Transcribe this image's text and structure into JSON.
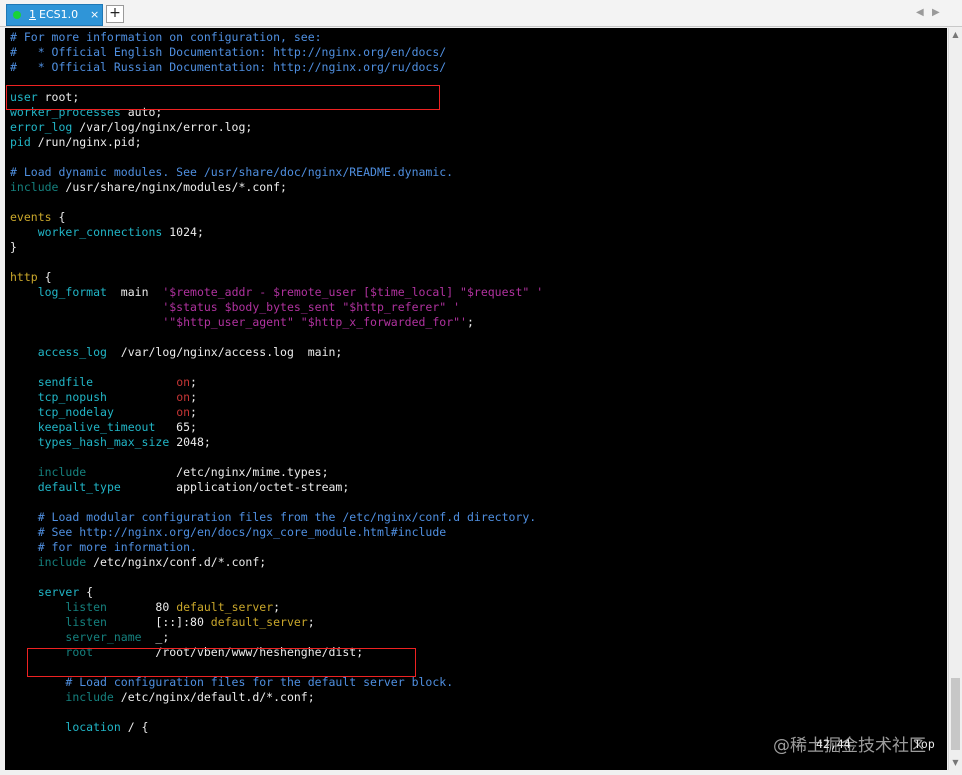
{
  "tabs": [
    {
      "number": "1",
      "label": "ECS1.0",
      "close": "×"
    }
  ],
  "new_tab_label": "+",
  "nav": {
    "prev": "◀",
    "next": "▶"
  },
  "lines": [
    [
      {
        "t": "# For more information on configuration, see:",
        "c": "comment"
      }
    ],
    [
      {
        "t": "#   * Official English Documentation: http://nginx.org/en/docs/",
        "c": "comment"
      }
    ],
    [
      {
        "t": "#   * Official Russian Documentation: http://nginx.org/ru/docs/",
        "c": "comment"
      }
    ],
    [
      {
        "t": ""
      }
    ],
    [
      {
        "t": "user",
        "c": "key"
      },
      {
        "t": " root;"
      }
    ],
    [
      {
        "t": "worker_processes",
        "c": "key"
      },
      {
        "t": " auto;"
      }
    ],
    [
      {
        "t": "error_log",
        "c": "key"
      },
      {
        "t": " /var/log/nginx/error.log;"
      }
    ],
    [
      {
        "t": "pid",
        "c": "key"
      },
      {
        "t": " /run/nginx.pid;"
      }
    ],
    [
      {
        "t": ""
      }
    ],
    [
      {
        "t": "# Load dynamic modules. See /usr/share/doc/nginx/README.dynamic.",
        "c": "comment"
      }
    ],
    [
      {
        "t": "include",
        "c": "dim"
      },
      {
        "t": " /usr/share/nginx/modules/*.conf;"
      }
    ],
    [
      {
        "t": ""
      }
    ],
    [
      {
        "t": "events",
        "c": "val"
      },
      {
        "t": " {"
      }
    ],
    [
      {
        "t": "    "
      },
      {
        "t": "worker_connections",
        "c": "key"
      },
      {
        "t": " 1024;"
      }
    ],
    [
      {
        "t": "}"
      }
    ],
    [
      {
        "t": ""
      }
    ],
    [
      {
        "t": "http",
        "c": "val"
      },
      {
        "t": " {"
      }
    ],
    [
      {
        "t": "    "
      },
      {
        "t": "log_format",
        "c": "key"
      },
      {
        "t": "  main  "
      },
      {
        "t": "'$remote_addr - $remote_user [$time_local] \"$request\" '",
        "c": "str"
      }
    ],
    [
      {
        "t": "                      "
      },
      {
        "t": "'$status $body_bytes_sent \"$http_referer\" '",
        "c": "str"
      }
    ],
    [
      {
        "t": "                      "
      },
      {
        "t": "'\"$http_user_agent\" \"$http_x_forwarded_for\"'",
        "c": "str"
      },
      {
        "t": ";"
      }
    ],
    [
      {
        "t": ""
      }
    ],
    [
      {
        "t": "    "
      },
      {
        "t": "access_log",
        "c": "key"
      },
      {
        "t": "  /var/log/nginx/access.log  main;"
      }
    ],
    [
      {
        "t": ""
      }
    ],
    [
      {
        "t": "    "
      },
      {
        "t": "sendfile",
        "c": "key"
      },
      {
        "t": "            "
      },
      {
        "t": "on",
        "c": "on"
      },
      {
        "t": ";"
      }
    ],
    [
      {
        "t": "    "
      },
      {
        "t": "tcp_nopush",
        "c": "key"
      },
      {
        "t": "          "
      },
      {
        "t": "on",
        "c": "on"
      },
      {
        "t": ";"
      }
    ],
    [
      {
        "t": "    "
      },
      {
        "t": "tcp_nodelay",
        "c": "key"
      },
      {
        "t": "         "
      },
      {
        "t": "on",
        "c": "on"
      },
      {
        "t": ";"
      }
    ],
    [
      {
        "t": "    "
      },
      {
        "t": "keepalive_timeout",
        "c": "key"
      },
      {
        "t": "   65;"
      }
    ],
    [
      {
        "t": "    "
      },
      {
        "t": "types_hash_max_size",
        "c": "key"
      },
      {
        "t": " 2048;"
      }
    ],
    [
      {
        "t": ""
      }
    ],
    [
      {
        "t": "    "
      },
      {
        "t": "include",
        "c": "dim"
      },
      {
        "t": "             /etc/nginx/mime.types;"
      }
    ],
    [
      {
        "t": "    "
      },
      {
        "t": "default_type",
        "c": "key"
      },
      {
        "t": "        application/octet-stream;"
      }
    ],
    [
      {
        "t": ""
      }
    ],
    [
      {
        "t": "    "
      },
      {
        "t": "# Load modular configuration files from the /etc/nginx/conf.d directory.",
        "c": "comment"
      }
    ],
    [
      {
        "t": "    "
      },
      {
        "t": "# See http://nginx.org/en/docs/ngx_core_module.html#include",
        "c": "comment"
      }
    ],
    [
      {
        "t": "    "
      },
      {
        "t": "# for more information.",
        "c": "comment"
      }
    ],
    [
      {
        "t": "    "
      },
      {
        "t": "include",
        "c": "dim"
      },
      {
        "t": " /etc/nginx/conf.d/*.conf;"
      }
    ],
    [
      {
        "t": ""
      }
    ],
    [
      {
        "t": "    "
      },
      {
        "t": "server",
        "c": "key"
      },
      {
        "t": " {"
      }
    ],
    [
      {
        "t": "        "
      },
      {
        "t": "listen",
        "c": "dim"
      },
      {
        "t": "       80 "
      },
      {
        "t": "default_server",
        "c": "val"
      },
      {
        "t": ";"
      }
    ],
    [
      {
        "t": "        "
      },
      {
        "t": "listen",
        "c": "dim"
      },
      {
        "t": "       [::]:80 "
      },
      {
        "t": "default_server",
        "c": "val"
      },
      {
        "t": ";"
      }
    ],
    [
      {
        "t": "        "
      },
      {
        "t": "server_name",
        "c": "dim"
      },
      {
        "t": "  _;"
      }
    ],
    [
      {
        "t": "        "
      },
      {
        "t": "root",
        "c": "dim"
      },
      {
        "t": "         /root/vben/www/heshengh"
      },
      {
        "t": "e",
        "c": "cursor"
      },
      {
        "t": "/dist;"
      }
    ],
    [
      {
        "t": ""
      }
    ],
    [
      {
        "t": "        "
      },
      {
        "t": "# Load configuration files for the default server block.",
        "c": "comment"
      }
    ],
    [
      {
        "t": "        "
      },
      {
        "t": "include",
        "c": "dim"
      },
      {
        "t": " /etc/nginx/default.d/*.conf;"
      }
    ],
    [
      {
        "t": ""
      }
    ],
    [
      {
        "t": "        "
      },
      {
        "t": "location",
        "c": "key"
      },
      {
        "t": " / {"
      }
    ]
  ],
  "status": {
    "position": "42,44",
    "scroll": "Top"
  },
  "watermark": "@稀土掘金技术社区",
  "scrollbar": {
    "up": "▲",
    "down": "▼"
  },
  "colors": {
    "comment": "#4f8fe0",
    "key": "#21b5c6",
    "dim": "#15807e",
    "string": "#b0329f",
    "value": "#c9a72b",
    "on": "#c43535",
    "cursor": "#2ca23a",
    "highlight_box": "#e22222",
    "tab": "#2f95d8"
  }
}
